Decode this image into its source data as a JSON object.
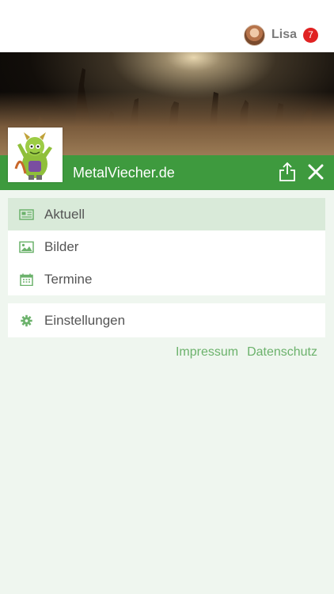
{
  "header": {
    "user_name": "Lisa",
    "notification_count": "7",
    "avatar_icon": "user-avatar"
  },
  "banner": {
    "image": "concert-crowd-photo",
    "site_title": "MetalViecher.de",
    "logo": "metalviecher-mascot-logo",
    "share_icon": "share-icon",
    "close_icon": "close-icon",
    "bar_color": "#3e9a3e"
  },
  "menu": {
    "primary": [
      {
        "label": "Aktuell",
        "icon": "newspaper-icon",
        "active": true
      },
      {
        "label": "Bilder",
        "icon": "image-icon",
        "active": false
      },
      {
        "label": "Termine",
        "icon": "calendar-icon",
        "active": false
      }
    ],
    "secondary": [
      {
        "label": "Einstellungen",
        "icon": "gear-icon",
        "active": false
      }
    ]
  },
  "footer": {
    "impressum": "Impressum",
    "datenschutz": "Datenschutz"
  },
  "colors": {
    "accent": "#3e9a3e",
    "icon": "#6cb26c",
    "active_bg": "#d9ead9",
    "badge": "#e02222",
    "page_bg": "#eff6ef"
  }
}
